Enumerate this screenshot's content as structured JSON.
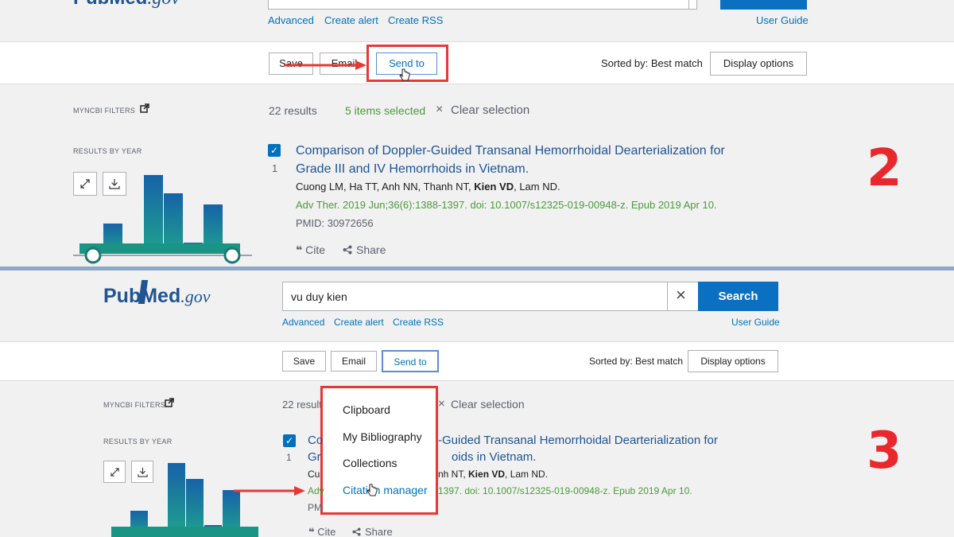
{
  "top_panel": {
    "logo": {
      "pub": "Pub",
      "med": "Med",
      "gov": ".gov"
    },
    "links": {
      "advanced": "Advanced",
      "create_alert": "Create alert",
      "create_rss": "Create RSS",
      "user_guide": "User Guide"
    },
    "toolbar": {
      "save": "Save",
      "email": "Email",
      "send_to": "Send to",
      "sorted_by": "Sorted by: Best match",
      "display_options": "Display options"
    },
    "filters": {
      "myncbi_filters": "MYNCBI FILTERS",
      "results_by_year": "RESULTS BY YEAR"
    },
    "results_bar": {
      "count": "22 results",
      "selected": "5 items selected",
      "clear_icon": "×",
      "clear": "Clear selection"
    },
    "step": "2"
  },
  "bottom_panel": {
    "logo": {
      "pub": "Pub",
      "med": "Med",
      "gov": ".gov"
    },
    "search": {
      "value": "vu duy kien",
      "clear_icon": "×",
      "button": "Search"
    },
    "links": {
      "advanced": "Advanced",
      "create_alert": "Create alert",
      "create_rss": "Create RSS",
      "user_guide": "User Guide"
    },
    "toolbar": {
      "save": "Save",
      "email": "Email",
      "send_to": "Send to",
      "sorted_by": "Sorted by: Best match",
      "display_options": "Display options"
    },
    "filters": {
      "myncbi_filters": "MYNCBI FILTERS",
      "results_by_year": "RESULTS BY YEAR"
    },
    "results_bar": {
      "count": "22 results",
      "clear_icon": "×",
      "clear": "Clear selection"
    },
    "send_to_menu": [
      "Clipboard",
      "My Bibliography",
      "Collections",
      "Citation manager"
    ],
    "step": "3"
  },
  "article": {
    "index": "1",
    "title_line1": "Comparison of Doppler-Guided Transanal Hemorrhoidal Dearterialization for",
    "title_line2": "Grade III and IV Hemorrhoids in Vietnam.",
    "title_line1_partial": "-Guided Transanal Hemorrhoidal Dearterialization for",
    "title_line2_partial": "oids in Vietnam.",
    "authors_pre": "Cuong LM, Ha TT, Anh NN, Thanh NT, ",
    "authors_bold": "Kien VD",
    "authors_post": ", Lam ND.",
    "authors_partial_pre": "nh NT, ",
    "journal": "Adv Ther. 2019 Jun;36(6):1388-1397. doi: 10.1007/s12325-019-00948-z. Epub 2019 Apr 10.",
    "journal_partial": "1397. doi: 10.1007/s12325-019-00948-z. Epub 2019 Apr 10.",
    "pmid": "PMID: 30972656",
    "cite": "Cite",
    "share": "Share",
    "cite_icon": "❝",
    "share_icon": "share-icon"
  },
  "colors": {
    "accent": "#0071bc",
    "search_button": "#0b6fc2",
    "annotation_red": "#e53935",
    "teal_start": "#1f9a8e",
    "teal_end": "#1762a8"
  }
}
